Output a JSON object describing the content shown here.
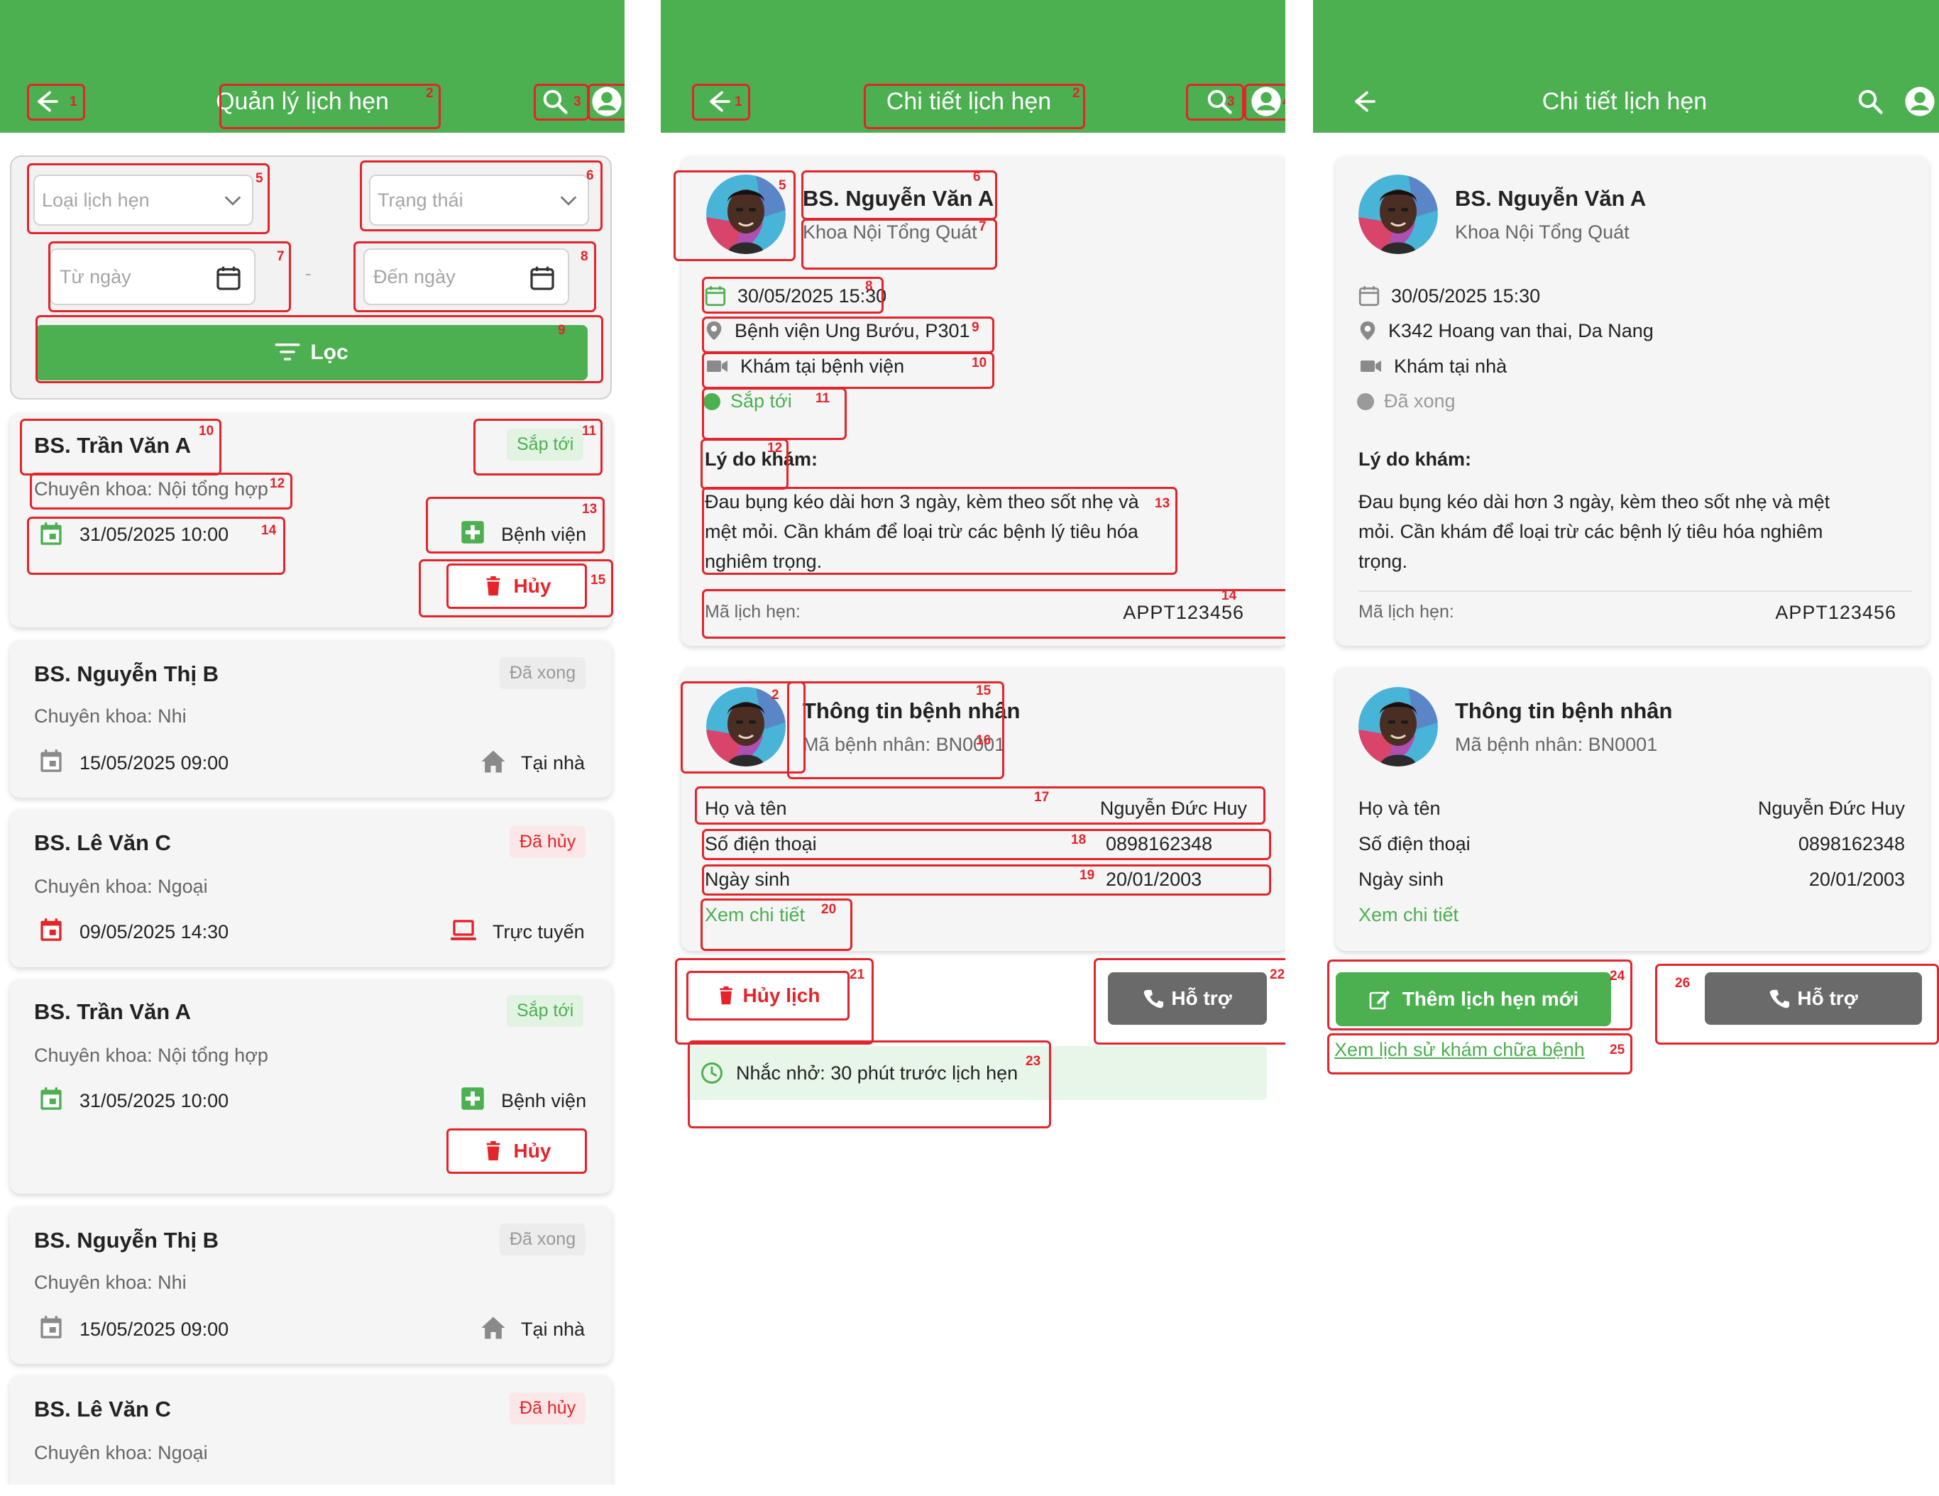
{
  "screen1": {
    "header": {
      "title": "Quản lý lịch hẹn"
    },
    "filter": {
      "type_placeholder": "Loại lịch hẹn",
      "status_placeholder": "Trạng thái",
      "from_placeholder": "Từ ngày",
      "to_placeholder": "Đến ngày",
      "separator": "-",
      "filter_label": "Lọc"
    },
    "appointments": [
      {
        "doctor": "BS. Trần Văn A",
        "specialty": "Chuyên khoa: Nội tổng hợp",
        "datetime": "31/05/2025 10:00",
        "status": "Sắp tới",
        "location": "Bệnh viện",
        "cancel_label": "Hủy"
      },
      {
        "doctor": "BS. Nguyễn Thị B",
        "specialty": "Chuyên khoa: Nhi",
        "datetime": "15/05/2025 09:00",
        "status": "Đã xong",
        "location": "Tại nhà"
      },
      {
        "doctor": "BS. Lê Văn C",
        "specialty": "Chuyên khoa: Ngoại",
        "datetime": "09/05/2025 14:30",
        "status": "Đã hủy",
        "location": "Trực tuyến"
      },
      {
        "doctor": "BS. Trần Văn A",
        "specialty": "Chuyên khoa: Nội tổng hợp",
        "datetime": "31/05/2025 10:00",
        "status": "Sắp tới",
        "location": "Bệnh viện",
        "cancel_label": "Hủy"
      },
      {
        "doctor": "BS. Nguyễn Thị B",
        "specialty": "Chuyên khoa: Nhi",
        "datetime": "15/05/2025 09:00",
        "status": "Đã xong",
        "location": "Tại nhà"
      },
      {
        "doctor": "BS. Lê Văn C",
        "specialty": "Chuyên khoa: Ngoại",
        "status": "Đã hủy"
      }
    ]
  },
  "screen2": {
    "header": {
      "title": "Chi tiết lịch hẹn"
    },
    "doctor": {
      "name": "BS. Nguyễn Văn A",
      "department": "Khoa Nội Tổng Quát"
    },
    "datetime": "30/05/2025 15:30",
    "location": "Bệnh viện Ung Bướu, P301",
    "mode": "Khám tại bệnh viện",
    "status": "Sắp tới",
    "reason_label": "Lý do khám:",
    "reason": "Đau bụng kéo dài hơn 3 ngày, kèm theo sốt nhẹ và mệt mỏi. Cần khám để loại trừ các bệnh lý tiêu hóa nghiêm trọng.",
    "code_label": "Mã lịch hẹn:",
    "code": "APPT123456",
    "patient": {
      "title": "Thông tin bệnh nhân",
      "id_text": "Mã bệnh nhân: BN0001",
      "name_label": "Họ và tên",
      "name": "Nguyễn Đức Huy",
      "phone_label": "Số điện thoại",
      "phone": "0898162348",
      "dob_label": "Ngày sinh",
      "dob": "20/01/2003",
      "detail_link": "Xem chi tiết"
    },
    "cancel_label": "Hủy lịch",
    "support_label": "Hỗ trợ",
    "reminder": "Nhắc nhở: 30 phút trước lịch hẹn"
  },
  "screen3": {
    "header": {
      "title": "Chi tiết lịch hẹn"
    },
    "doctor": {
      "name": "BS. Nguyễn Văn A",
      "department": "Khoa Nội Tổng Quát"
    },
    "datetime": "30/05/2025 15:30",
    "location": "K342 Hoang van thai, Da Nang",
    "mode": "Khám tại nhà",
    "status": "Đã xong",
    "reason_label": "Lý do khám:",
    "reason": "Đau bụng kéo dài hơn 3 ngày, kèm theo sốt nhẹ và mệt mỏi. Cần khám để loại trừ các bệnh lý tiêu hóa nghiêm trọng.",
    "code_label": "Mã lịch hẹn:",
    "code": "APPT123456",
    "patient": {
      "title": "Thông tin bệnh nhân",
      "id_text": "Mã bệnh nhân: BN0001",
      "name_label": "Họ và tên",
      "name": "Nguyễn Đức Huy",
      "phone_label": "Số điện thoại",
      "phone": "0898162348",
      "dob_label": "Ngày sinh",
      "dob": "20/01/2003",
      "detail_link": "Xem chi tiết"
    },
    "new_label": "Thêm lịch hẹn mới",
    "history_link": "Xem lịch sử khám chữa bệnh",
    "support_label": "Hỗ trợ"
  },
  "annotations": {
    "s1": [
      "1",
      "2",
      "3",
      "4",
      "5",
      "6",
      "7",
      "8",
      "9",
      "10",
      "11",
      "12",
      "13",
      "14",
      "15"
    ],
    "s2": [
      "1",
      "2",
      "3",
      "4",
      "5",
      "6",
      "7",
      "8",
      "9",
      "10",
      "11",
      "12",
      "13",
      "14",
      "2",
      "15",
      "16",
      "17",
      "18",
      "19",
      "20",
      "21",
      "22",
      "23"
    ],
    "s3": [
      "24",
      "25",
      "26"
    ]
  },
  "colors": {
    "primary": "#4caf50",
    "danger": "#e3242b",
    "card": "#f5f5f5",
    "neutral_button": "#6a6a6a"
  },
  "icons": [
    "arrow-left-icon",
    "search-icon",
    "user-circle-icon",
    "chevron-down-icon",
    "calendar-icon",
    "filter-icon",
    "calendar-event-icon",
    "hospital-plus-icon",
    "home-icon",
    "laptop-icon",
    "trash-icon",
    "map-pin-icon",
    "video-icon",
    "status-dot-icon",
    "phone-icon",
    "clock-icon",
    "edit-icon"
  ]
}
